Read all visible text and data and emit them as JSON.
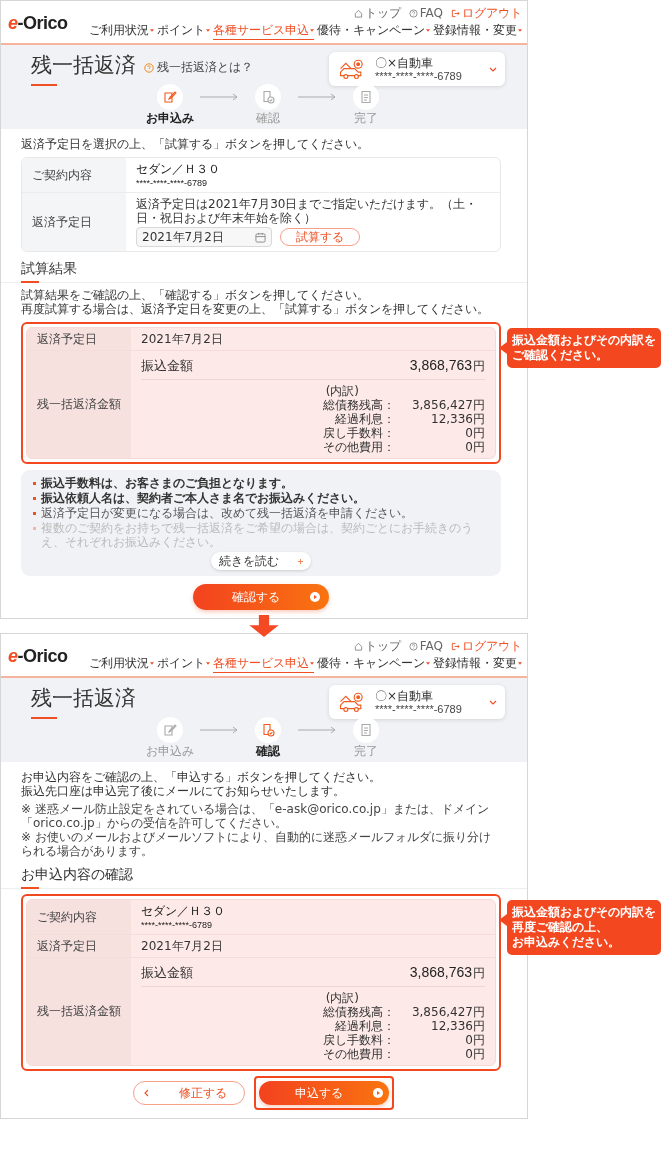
{
  "application_screen": {
    "header": {
      "logo_mark": "e",
      "logo_text": "-Orico",
      "top_links": [
        {
          "kind": "home",
          "label": "トップ"
        },
        {
          "kind": "faq",
          "label": "FAQ"
        },
        {
          "kind": "logout",
          "label": "ログアウト"
        }
      ],
      "nav": [
        {
          "label": "ご利用状況",
          "selected": false
        },
        {
          "label": "ポイント",
          "selected": false
        },
        {
          "label": "各種サービス申込",
          "selected": true
        },
        {
          "label": "優待・キャンペーン",
          "selected": false
        },
        {
          "label": "登録情報・変更",
          "selected": false
        }
      ]
    },
    "title": "残一括返済",
    "help_link": "残一括返済とは？",
    "contract": {
      "name": "〇×自動車",
      "number": "****-****-****-6789"
    },
    "steps": [
      {
        "label": "お申込み",
        "selected": true
      },
      {
        "label": "確認",
        "selected": false
      },
      {
        "label": "完了",
        "selected": false
      }
    ],
    "intro": [
      "返済予定日を選択の上、「試算する」ボタンを押してください。"
    ],
    "input_table": {
      "highlighted": false,
      "rows": [
        {
          "kind": "contract",
          "label": "ご契約内容",
          "lines": [
            "セダン／Ｈ３０",
            "****-****-****-6789"
          ]
        },
        {
          "kind": "date",
          "label": "返済予定日",
          "note": "返済予定日は2021年7月30日までご指定いただけます。（土・日・祝日および年末年始を除く）",
          "date_value": "2021年7月2日",
          "button": "試算する"
        }
      ]
    },
    "result": {
      "heading": "試算結果",
      "intro": [
        "試算結果をご確認の上、「確認する」ボタンを押してください。",
        "再度試算する場合は、返済予定日を変更の上、「試算する」ボタンを押してください。"
      ],
      "table": {
        "highlighted": true,
        "rows": [
          {
            "kind": "text",
            "label": "返済予定日",
            "value": "2021年7月2日"
          },
          {
            "kind": "amount",
            "label": "残一括返済金額",
            "amount_label": "振込金額",
            "amount": "3,868,763",
            "unit": "円",
            "breakdown_label": "(内訳)",
            "breakdown": [
              {
                "label": "総債務残高：",
                "value": "3,856,427円"
              },
              {
                "label": "経過利息：",
                "value": "12,336円"
              },
              {
                "label": "戻し手数料：",
                "value": "0円"
              },
              {
                "label": "その他費用：",
                "value": "0円"
              }
            ]
          }
        ]
      },
      "callout": [
        "振込金額およびその内訳を",
        "ご確認ください。"
      ]
    },
    "notes": {
      "items": [
        {
          "kind": "strong",
          "text": "振込手数料は、お客さまのご負担となります。"
        },
        {
          "kind": "strong",
          "text": "振込依頼人名は、契約者ご本人さま名でお振込みください。"
        },
        {
          "kind": "normal",
          "text": "返済予定日が変更になる場合は、改めて残一括返済を申請ください。"
        },
        {
          "kind": "faded",
          "text": "複数のご契約をお持ちで残一括返済をご希望の場合は、契約ごとにお手続きのうえ、それぞれお振込みください。"
        }
      ],
      "more_button": "続きを読む"
    },
    "next_button": "確認する"
  },
  "confirmation_screen": {
    "header": {
      "logo_mark": "e",
      "logo_text": "-Orico",
      "top_links": [
        {
          "kind": "home",
          "label": "トップ"
        },
        {
          "kind": "faq",
          "label": "FAQ"
        },
        {
          "kind": "logout",
          "label": "ログアウト"
        }
      ],
      "nav": [
        {
          "label": "ご利用状況",
          "selected": false
        },
        {
          "label": "ポイント",
          "selected": false
        },
        {
          "label": "各種サービス申込",
          "selected": true
        },
        {
          "label": "優待・キャンペーン",
          "selected": false
        },
        {
          "label": "登録情報・変更",
          "selected": false
        }
      ]
    },
    "title": "残一括返済",
    "contract": {
      "name": "〇×自動車",
      "number": "****-****-****-6789"
    },
    "steps": [
      {
        "label": "お申込み",
        "selected": false
      },
      {
        "label": "確認",
        "selected": true
      },
      {
        "label": "完了",
        "selected": false
      }
    ],
    "intro": [
      "お申込内容をご確認の上、「申込する」ボタンを押してください。",
      "振込先口座は申込完了後にメールにてお知らせいたします。"
    ],
    "notices": [
      "※ 迷惑メール防止設定をされている場合は、「e-ask@orico.co.jp」または、ドメイン「orico.co.jp」からの受信を許可してください。",
      "※ お使いのメールおよびメールソフトにより、自動的に迷惑メールフォルダに振り分けられる場合があります。"
    ],
    "review": {
      "heading": "お申込内容の確認",
      "table": {
        "highlighted": true,
        "rows": [
          {
            "kind": "contract",
            "label": "ご契約内容",
            "lines": [
              "セダン／Ｈ３０",
              "****-****-****-6789"
            ]
          },
          {
            "kind": "text",
            "label": "返済予定日",
            "value": "2021年7月2日"
          },
          {
            "kind": "amount",
            "label": "残一括返済金額",
            "amount_label": "振込金額",
            "amount": "3,868,763",
            "unit": "円",
            "breakdown_label": "(内訳)",
            "breakdown": [
              {
                "label": "総債務残高：",
                "value": "3,856,427円"
              },
              {
                "label": "経過利息：",
                "value": "12,336円"
              },
              {
                "label": "戻し手数料：",
                "value": "0円"
              },
              {
                "label": "その他費用：",
                "value": "0円"
              }
            ]
          }
        ]
      },
      "callout": [
        "振込金額およびその内訳を",
        "再度ご確認の上、",
        "お申込みください。"
      ]
    },
    "buttons": [
      {
        "kind": "back",
        "label": "修正する",
        "highlighted": false
      },
      {
        "kind": "submit",
        "label": "申込する",
        "highlighted": true
      }
    ]
  }
}
